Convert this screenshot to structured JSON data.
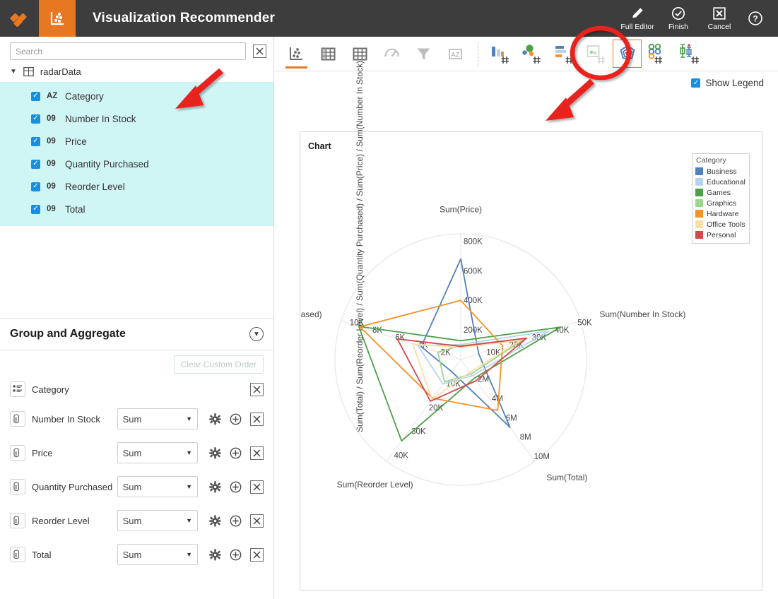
{
  "app": {
    "title": "Visualization Recommender",
    "logo_icon": "hexagon-tools-icon",
    "module_icon": "scatter-chart-icon"
  },
  "topbar_actions": [
    {
      "label": "Full Editor",
      "icon": "pencil-icon"
    },
    {
      "label": "Finish",
      "icon": "check-circle-icon"
    },
    {
      "label": "Cancel",
      "icon": "x-box-icon"
    }
  ],
  "help": {
    "icon": "question-circle-icon"
  },
  "sidebar": {
    "search": {
      "value": "",
      "placeholder": "Search",
      "clear_icon": "x-box-icon"
    },
    "dataset": {
      "label": "radarData",
      "caret_icon": "caret-down-icon",
      "table_icon": "table-icon"
    },
    "fields": [
      {
        "label": "Category",
        "type": "AZ",
        "checked": true
      },
      {
        "label": "Number In Stock",
        "type": "09",
        "checked": true
      },
      {
        "label": "Price",
        "type": "09",
        "checked": true
      },
      {
        "label": "Quantity Purchased",
        "type": "09",
        "checked": true
      },
      {
        "label": "Reorder Level",
        "type": "09",
        "checked": true
      },
      {
        "label": "Total",
        "type": "09",
        "checked": true
      }
    ]
  },
  "group_aggregate": {
    "title": "Group and Aggregate",
    "collapse_icon": "chevron-down-circle-icon",
    "clear_order_label": "Clear Custom Order",
    "rows": [
      {
        "field": "Category",
        "icon": "category-list-icon",
        "aggregate": null,
        "has_gear": false,
        "has_plus": false,
        "remove_icon": "x-box-icon"
      },
      {
        "field": "Number In Stock",
        "icon": "measure-icon",
        "aggregate": "Sum",
        "has_gear": true,
        "has_plus": true,
        "remove_icon": "x-box-icon"
      },
      {
        "field": "Price",
        "icon": "measure-icon",
        "aggregate": "Sum",
        "has_gear": true,
        "has_plus": true,
        "remove_icon": "x-box-icon"
      },
      {
        "field": "Quantity Purchased",
        "icon": "measure-icon",
        "aggregate": "Sum",
        "has_gear": true,
        "has_plus": true,
        "remove_icon": "x-box-icon"
      },
      {
        "field": "Reorder Level",
        "icon": "measure-icon",
        "aggregate": "Sum",
        "has_gear": true,
        "has_plus": true,
        "remove_icon": "x-box-icon"
      },
      {
        "field": "Total",
        "icon": "measure-icon",
        "aggregate": "Sum",
        "has_gear": true,
        "has_plus": true,
        "remove_icon": "x-box-icon"
      }
    ]
  },
  "chart_toolbar": {
    "left_group": [
      {
        "icon": "scatter-plot-icon",
        "active": true
      },
      {
        "icon": "pivot-table-icon",
        "active": false
      },
      {
        "icon": "grid-table-icon",
        "active": false
      },
      {
        "icon": "gauge-icon",
        "active": false
      },
      {
        "icon": "funnel-icon",
        "active": false
      },
      {
        "icon": "az-sort-icon",
        "active": false
      }
    ],
    "right_group": [
      {
        "icon": "bar-chart-icon",
        "selected": false
      },
      {
        "icon": "bubble-chart-icon",
        "selected": false
      },
      {
        "icon": "horizontal-bar-chart-icon",
        "selected": false
      },
      {
        "icon": "scatter-matrix-icon",
        "selected": false
      },
      {
        "icon": "radar-chart-icon",
        "selected": true
      },
      {
        "icon": "parallel-coordinates-icon",
        "selected": false
      },
      {
        "icon": "box-plot-icon",
        "selected": false
      }
    ]
  },
  "show_legend": {
    "label": "Show Legend",
    "checked": true
  },
  "chart_card": {
    "caption": "Chart"
  },
  "annotations": {
    "highlight_circle_color": "#e8211c",
    "arrow_color": "#e8211c"
  },
  "chart_data": {
    "type": "radar",
    "title": "Chart",
    "legend_title": "Category",
    "legend_position": "top-right",
    "grid": true,
    "vertical_axis_label": "Sum(Total) / Sum(Reorder Level) / Sum(Quantity Purchased) / Sum(Price) / Sum(Number In Stock)",
    "axes": [
      {
        "name": "Sum(Price)",
        "angle_deg": 90,
        "ticks": [
          "200K",
          "400K",
          "600K",
          "800K"
        ],
        "max": 1000000
      },
      {
        "name": "Sum(Number In Stock)",
        "angle_deg": 18,
        "ticks": [
          "10K",
          "20K",
          "30K",
          "40K",
          "50K"
        ],
        "max": 60000
      },
      {
        "name": "Sum(Total)",
        "angle_deg": -54,
        "ticks": [
          "2M",
          "4M",
          "6M",
          "8M",
          "10M"
        ],
        "max": 12000000
      },
      {
        "name": "Sum(Reorder Level)",
        "angle_deg": -126,
        "ticks": [
          "10K",
          "20K",
          "30K",
          "40K"
        ],
        "max": 50000
      },
      {
        "name": "Sum(Quantity Purchased)",
        "angle_deg": 162,
        "ticks": [
          "2K",
          "4K",
          "6K",
          "8K",
          "10K"
        ],
        "max": 11500
      }
    ],
    "categories": [
      "Business",
      "Educational",
      "Games",
      "Graphics",
      "Hardware",
      "Office Tools",
      "Personal"
    ],
    "colors": {
      "Business": "#4f81bd",
      "Educational": "#b8d4ec",
      "Games": "#4ca047",
      "Graphics": "#9ed58f",
      "Hardware": "#f79121",
      "Office Tools": "#fbe0a6",
      "Personal": "#d6474a"
    },
    "series": [
      {
        "name": "Business",
        "values": {
          "Sum(Price)": 800000,
          "Sum(Number In Stock)": 9000,
          "Sum(Total)": 8000000,
          "Sum(Reorder Level)": 6000,
          "Sum(Quantity Purchased)": 3800
        }
      },
      {
        "name": "Educational",
        "values": {
          "Sum(Price)": 120000,
          "Sum(Number In Stock)": 44000,
          "Sum(Total)": 1900000,
          "Sum(Reorder Level)": 12000,
          "Sum(Quantity Purchased)": 4100
        }
      },
      {
        "name": "Games",
        "values": {
          "Sum(Price)": 150000,
          "Sum(Number In Stock)": 50000,
          "Sum(Total)": 2200000,
          "Sum(Reorder Level)": 40000,
          "Sum(Quantity Purchased)": 9800
        }
      },
      {
        "name": "Graphics",
        "values": {
          "Sum(Price)": 110000,
          "Sum(Number In Stock)": 32000,
          "Sum(Total)": 1700000,
          "Sum(Reorder Level)": 11000,
          "Sum(Quantity Purchased)": 2200
        }
      },
      {
        "name": "Hardware",
        "values": {
          "Sum(Price)": 470000,
          "Sum(Number In Stock)": 21000,
          "Sum(Total)": 6000000,
          "Sum(Reorder Level)": 19000,
          "Sum(Quantity Purchased)": 9700
        }
      },
      {
        "name": "Office Tools",
        "values": {
          "Sum(Price)": 95000,
          "Sum(Number In Stock)": 30000,
          "Sum(Total)": 1500000,
          "Sum(Reorder Level)": 19500,
          "Sum(Quantity Purchased)": 4600
        }
      },
      {
        "name": "Personal",
        "values": {
          "Sum(Price)": 105000,
          "Sum(Number In Stock)": 33000,
          "Sum(Total)": 2500000,
          "Sum(Reorder Level)": 20500,
          "Sum(Quantity Purchased)": 6100
        }
      }
    ]
  }
}
